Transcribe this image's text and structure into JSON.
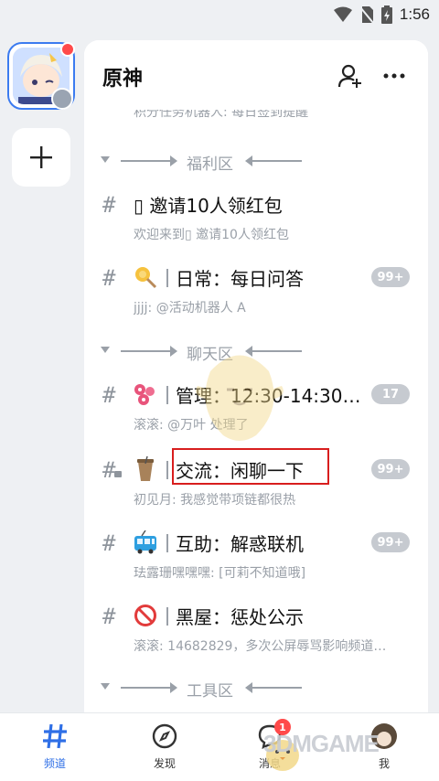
{
  "status_bar": {
    "time": "1:56"
  },
  "rail": {
    "add_label": "+"
  },
  "header": {
    "guild_name": "原神"
  },
  "partial_text": "积分任务机器人: 每日签到提醒",
  "sections": [
    {
      "title": "福利区"
    },
    {
      "title": "聊天区"
    },
    {
      "title": "工具区"
    }
  ],
  "channels": [
    {
      "name": "▯ 邀请10人领红包",
      "preview": "欢迎来到▯ 邀请10人领红包",
      "badge": "",
      "icon": "none"
    },
    {
      "name": "日常：每日问答",
      "preview": "jjjj: @活动机器人 A",
      "badge": "99+",
      "icon": "lollipop-icon"
    },
    {
      "name": "管理：12:30-14:30滚…",
      "preview": "滚滚: @万叶 处理了",
      "badge": "17",
      "icon": "flowers-icon"
    },
    {
      "name": "交流：闲聊一下",
      "preview": "初见月: 我感觉带项链都很热",
      "badge": "99+",
      "icon": "drink-icon"
    },
    {
      "name": "互助：解惑联机",
      "preview": "珐露珊嘿嘿嘿: [可莉不知道哦]",
      "badge": "99+",
      "icon": "trolleybus-icon"
    },
    {
      "name": "黑屋：惩处公示",
      "preview": "滚滚: 14682829，多次公屏辱骂影响频道…",
      "badge": "",
      "icon": "prohibited-icon"
    }
  ],
  "bottom_nav": {
    "tabs": [
      {
        "label": "频道"
      },
      {
        "label": "发现"
      },
      {
        "label": "消息",
        "badge": "1"
      },
      {
        "label": "我"
      }
    ]
  },
  "watermark": "3DMGAME",
  "colors": {
    "accent": "#2f6fe6",
    "highlight": "#d81e1e",
    "badge": "#c6cad0"
  }
}
